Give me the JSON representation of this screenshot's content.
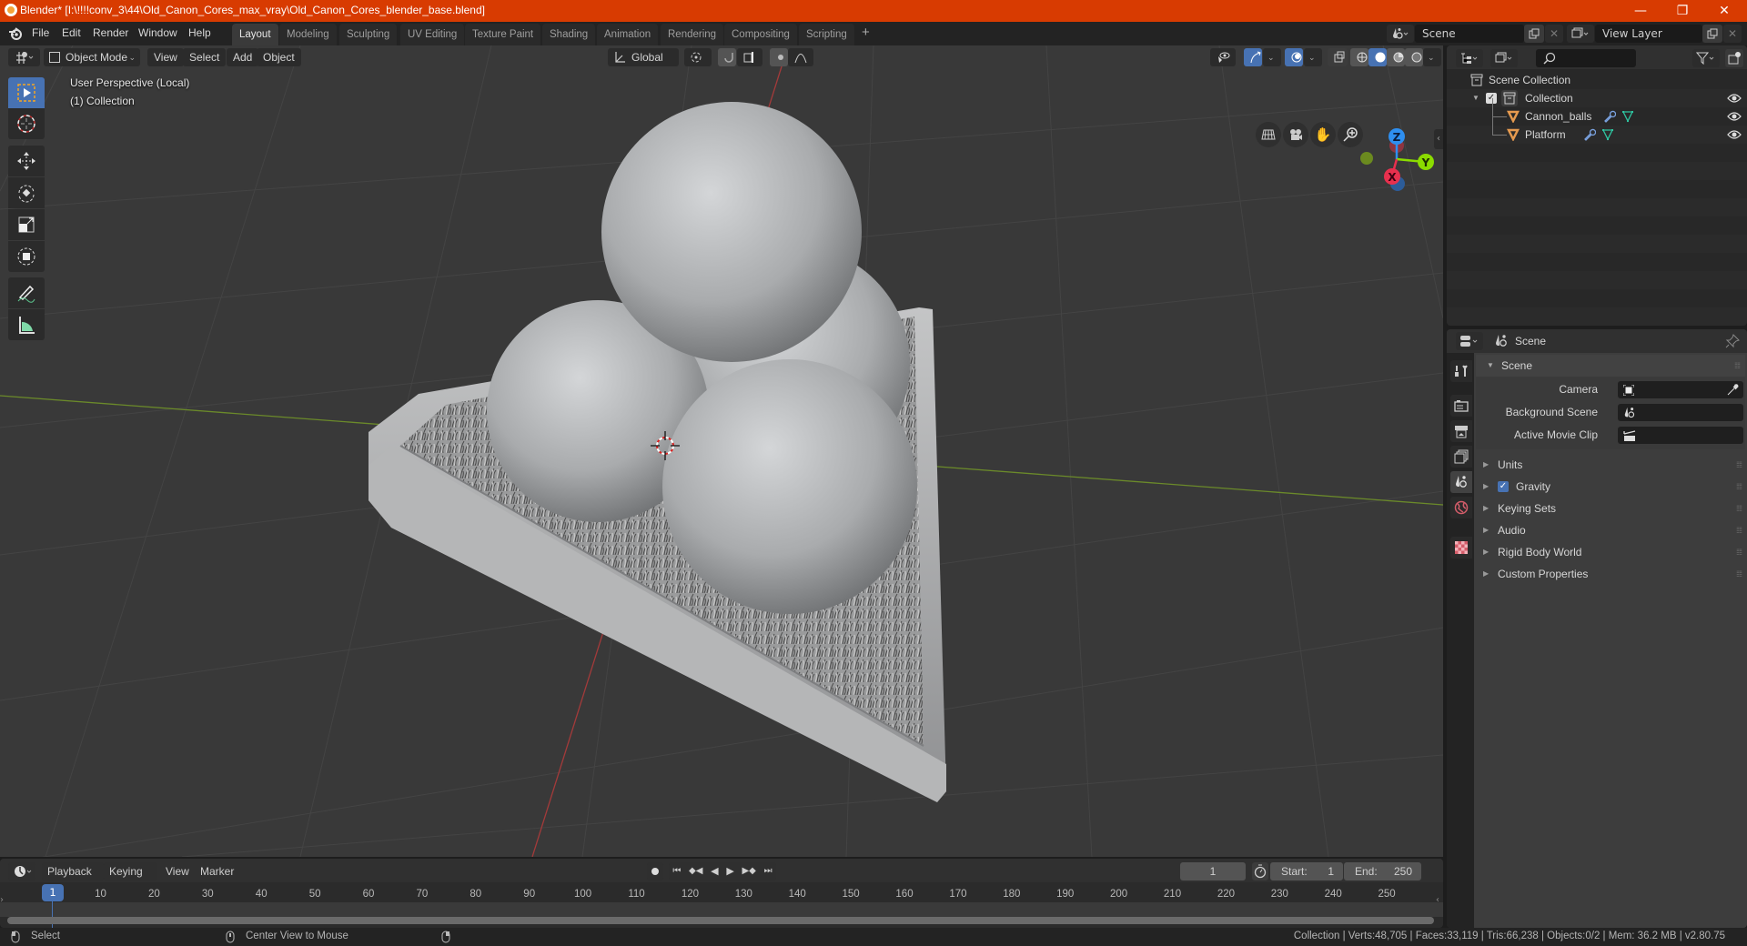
{
  "window": {
    "title": "Blender* [I:\\!!!!conv_3\\44\\Old_Canon_Cores_max_vray\\Old_Canon_Cores_blender_base.blend]",
    "controls": {
      "minimize": "—",
      "maximize": "❐",
      "close": "✕"
    }
  },
  "menubar": {
    "items": [
      "File",
      "Edit",
      "Render",
      "Window",
      "Help"
    ]
  },
  "workspaces": {
    "tabs": [
      "Layout",
      "Modeling",
      "Sculpting",
      "UV Editing",
      "Texture Paint",
      "Shading",
      "Animation",
      "Rendering",
      "Compositing",
      "Scripting"
    ],
    "active": "Layout",
    "add_label": "+"
  },
  "scene_selector": {
    "value": "Scene"
  },
  "viewlayer_selector": {
    "value": "View Layer"
  },
  "viewport": {
    "header": {
      "mode": "Object Mode",
      "menus": [
        "View",
        "Select",
        "Add",
        "Object"
      ],
      "transform_orientation": "Global"
    },
    "overlay_text": {
      "perspective": "User Perspective (Local)",
      "collection": "(1) Collection"
    },
    "gizmo": {
      "x": "X",
      "y": "Y",
      "z": "Z"
    },
    "colors": {
      "x_axis": "#e8304e",
      "y_axis": "#8bdc00",
      "z_axis": "#2e8ff0",
      "accent": "#4772b3"
    }
  },
  "toolbar": {
    "tools": [
      "select-box",
      "cursor",
      "move",
      "rotate",
      "scale",
      "transform",
      "annotate",
      "measure"
    ],
    "active": "select-box"
  },
  "outliner": {
    "search_placeholder": "",
    "root": "Scene Collection",
    "collection": "Collection",
    "objects": [
      {
        "name": "Cannon_balls"
      },
      {
        "name": "Platform"
      }
    ]
  },
  "properties": {
    "header_context": "Scene",
    "panel_title": "Scene",
    "fields": [
      {
        "label": "Camera",
        "value": ""
      },
      {
        "label": "Background Scene",
        "value": ""
      },
      {
        "label": "Active Movie Clip",
        "value": ""
      }
    ],
    "sections": [
      {
        "label": "Units",
        "checkbox": false
      },
      {
        "label": "Gravity",
        "checkbox": true,
        "checked": true
      },
      {
        "label": "Keying Sets",
        "checkbox": false
      },
      {
        "label": "Audio",
        "checkbox": false
      },
      {
        "label": "Rigid Body World",
        "checkbox": false
      },
      {
        "label": "Custom Properties",
        "checkbox": false
      }
    ]
  },
  "timeline": {
    "menus": [
      "Playback",
      "Keying",
      "View",
      "Marker"
    ],
    "current_frame": "1",
    "start_label": "Start:",
    "start": "1",
    "end_label": "End:",
    "end": "250",
    "ticks": [
      "10",
      "20",
      "30",
      "40",
      "50",
      "60",
      "70",
      "80",
      "90",
      "100",
      "110",
      "120",
      "130",
      "140",
      "150",
      "160",
      "170",
      "180",
      "190",
      "200",
      "210",
      "220",
      "230",
      "240",
      "250"
    ],
    "playhead": "1"
  },
  "statusbar": {
    "left_action": "Select",
    "middle_action": "Center View to Mouse",
    "stats": "Collection | Verts:48,705 | Faces:33,119 | Tris:66,238 | Objects:0/2 | Mem: 36.2 MB | v2.80.75"
  }
}
